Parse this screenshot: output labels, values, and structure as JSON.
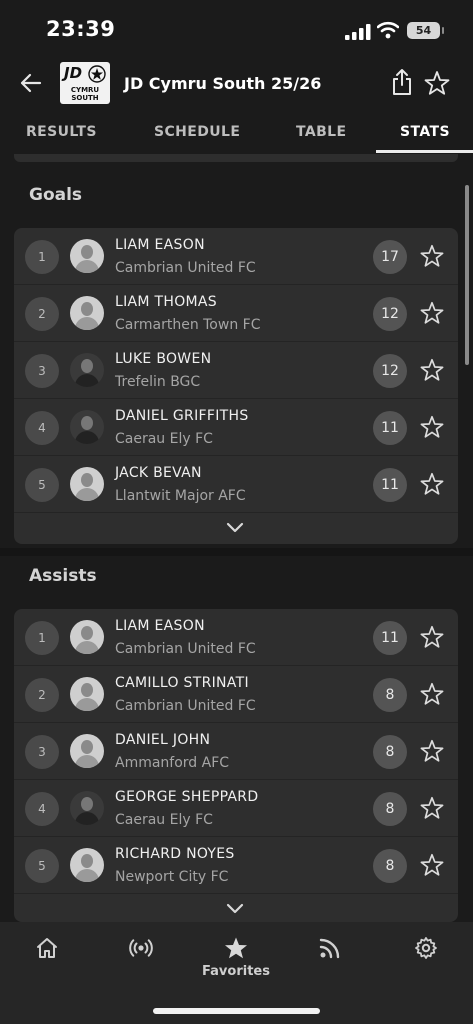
{
  "status_bar": {
    "time": "23:39",
    "battery": "54"
  },
  "header": {
    "title": "JD Cymru South 25/26",
    "logo_jd": "JD",
    "logo_text": "CYMRU SOUTH"
  },
  "tabs": [
    {
      "label": "RESULTS",
      "active": false
    },
    {
      "label": "SCHEDULE",
      "active": false
    },
    {
      "label": "TABLE",
      "active": false
    },
    {
      "label": "STATS",
      "active": true
    }
  ],
  "goals": {
    "title": "Goals",
    "rows": [
      {
        "rank": "1",
        "name": "LIAM EASON",
        "club": "Cambrian United FC",
        "value": "17"
      },
      {
        "rank": "2",
        "name": "LIAM THOMAS",
        "club": "Carmarthen Town FC",
        "value": "12"
      },
      {
        "rank": "3",
        "name": "LUKE BOWEN",
        "club": "Trefelin BGC",
        "value": "12"
      },
      {
        "rank": "4",
        "name": "DANIEL GRIFFITHS",
        "club": "Caerau Ely FC",
        "value": "11"
      },
      {
        "rank": "5",
        "name": "JACK BEVAN",
        "club": "Llantwit Major AFC",
        "value": "11"
      }
    ]
  },
  "assists": {
    "title": "Assists",
    "rows": [
      {
        "rank": "1",
        "name": "LIAM EASON",
        "club": "Cambrian United FC",
        "value": "11"
      },
      {
        "rank": "2",
        "name": "CAMILLO STRINATI",
        "club": "Cambrian United FC",
        "value": "8"
      },
      {
        "rank": "3",
        "name": "DANIEL JOHN",
        "club": "Ammanford AFC",
        "value": "8"
      },
      {
        "rank": "4",
        "name": "GEORGE SHEPPARD",
        "club": "Caerau Ely FC",
        "value": "8"
      },
      {
        "rank": "5",
        "name": "RICHARD NOYES",
        "club": "Newport City FC",
        "value": "8"
      }
    ]
  },
  "tabbar": {
    "items": [
      "home-icon",
      "live-icon",
      "star-icon",
      "feed-icon",
      "settings-icon"
    ],
    "active_label": "Favorites"
  }
}
